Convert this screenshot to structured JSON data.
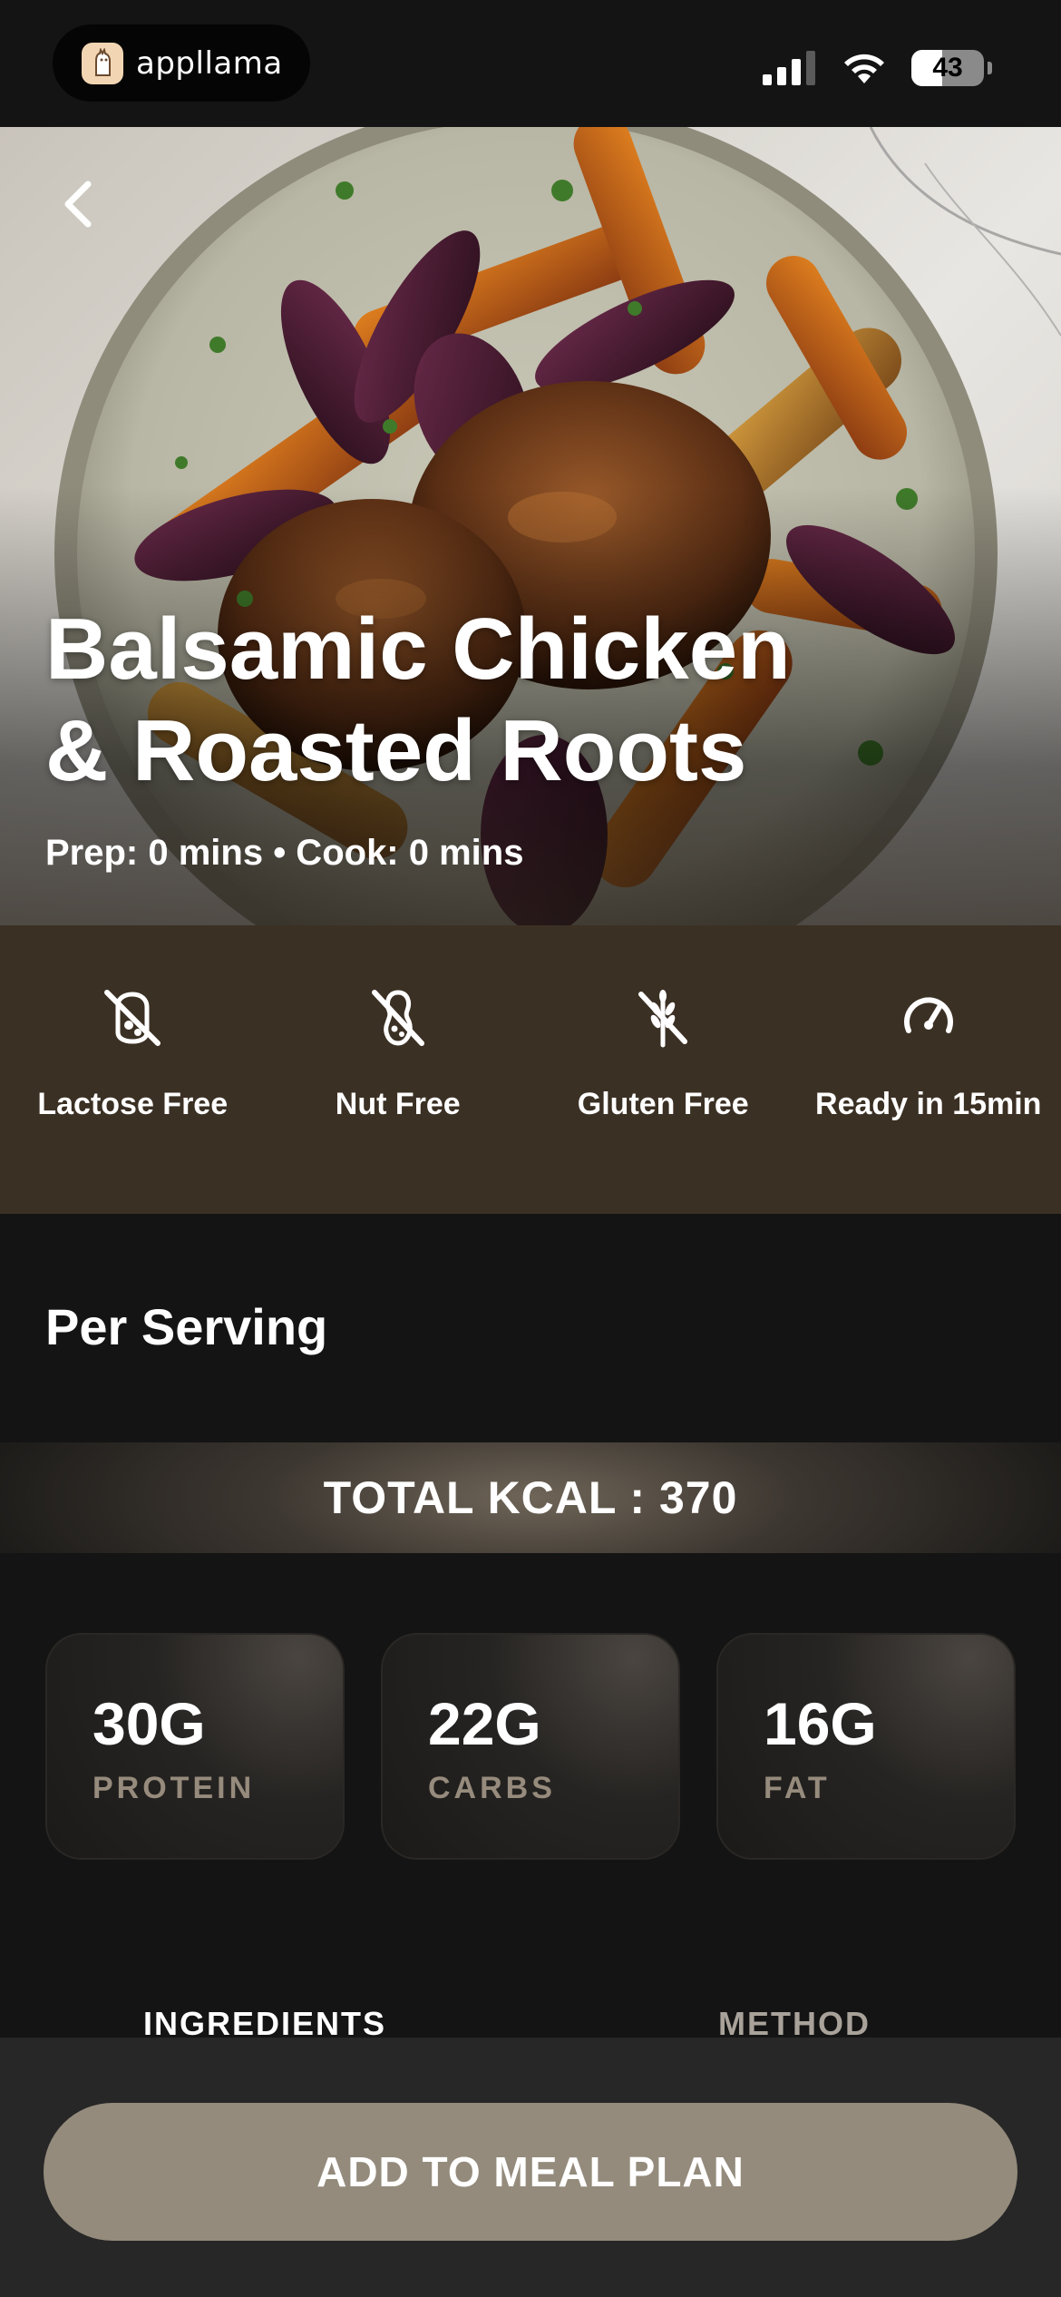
{
  "status_bar": {
    "app_name": "appllama",
    "battery_text": "43",
    "battery_level": 0.43,
    "icons": [
      "cellular-signal-icon",
      "wifi-icon",
      "battery-icon"
    ]
  },
  "hero": {
    "title_line1": "Balsamic Chicken",
    "title_line2": "& Roasted Roots",
    "meta": "Prep: 0 mins • Cook: 0 mins",
    "back_icon": "chevron-left-icon"
  },
  "diet_tags": [
    {
      "label": "Lactose Free",
      "icon": "no-milk-icon"
    },
    {
      "label": "Nut Free",
      "icon": "no-peanut-icon"
    },
    {
      "label": "Gluten Free",
      "icon": "no-wheat-icon"
    },
    {
      "label": "Ready in 15min",
      "icon": "speedometer-icon"
    }
  ],
  "nutrition": {
    "section_title": "Per Serving",
    "total_kcal": "TOTAL KCAL : 370",
    "macros": [
      {
        "value": "30G",
        "label": "PROTEIN"
      },
      {
        "value": "22G",
        "label": "CARBS"
      },
      {
        "value": "16G",
        "label": "FAT"
      }
    ]
  },
  "tabs": {
    "ingredients": "INGREDIENTS",
    "method": "METHOD"
  },
  "cta": {
    "add_to_meal_plan": "ADD TO MEAL PLAN"
  },
  "colors": {
    "background": "#141414",
    "diet_strip": "#3b3024",
    "accent_button": "#948b7c",
    "macro_label": "#968b7c"
  }
}
